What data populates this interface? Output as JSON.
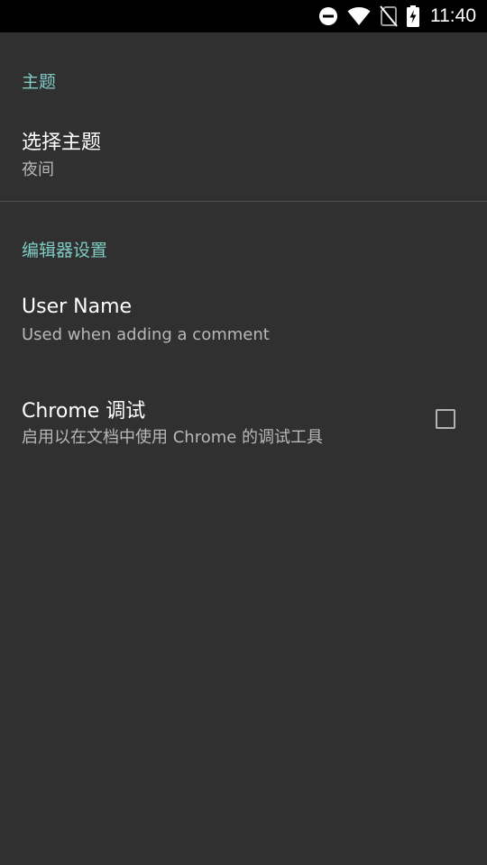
{
  "status_bar": {
    "time": "11:40",
    "icons": [
      "do-not-disturb-icon",
      "wifi-icon",
      "no-sim-icon",
      "battery-charging-icon"
    ]
  },
  "theme_section": {
    "header": "主题",
    "choose_theme": {
      "title": "选择主题",
      "summary": "夜间"
    }
  },
  "editor_section": {
    "header": "编辑器设置",
    "user_name": {
      "title": "User Name",
      "summary": "Used when adding a comment"
    },
    "chrome_debug": {
      "title": "Chrome 调试",
      "summary": "启用以在文档中使用 Chrome 的调试工具",
      "checked": false
    }
  },
  "colors": {
    "background": "#303030",
    "accent": "#80cbc4",
    "status_bar": "#000000"
  }
}
